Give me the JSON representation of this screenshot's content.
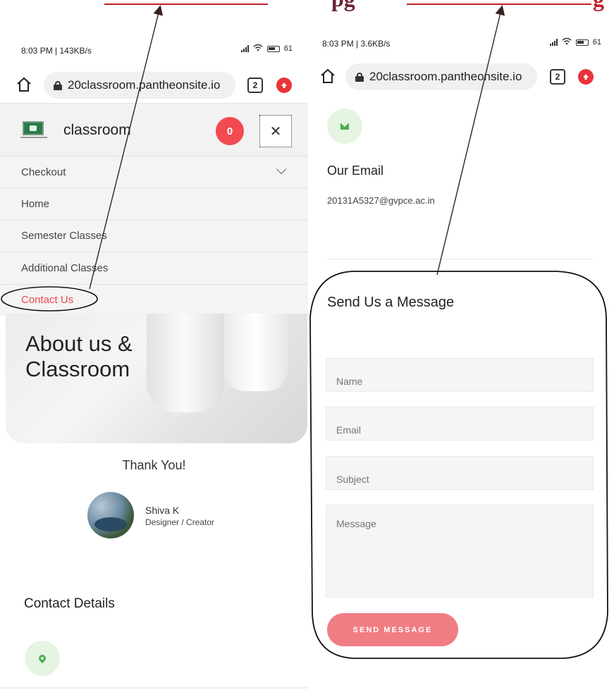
{
  "caption": {
    "mid_text": "pg",
    "right_text": "g"
  },
  "left_phone": {
    "status_time": "8:03 PM | 143KB/s",
    "battery": "61",
    "url": "20classroom.pantheonsite.io",
    "tab_count": "2",
    "site_title": "classroom",
    "cart_count": "0",
    "close_glyph": "✕",
    "menu": [
      {
        "label": "Checkout",
        "has_submenu": true
      },
      {
        "label": "Home"
      },
      {
        "label": "Semester Classes"
      },
      {
        "label": "Additional Classes"
      },
      {
        "label": "Contact Us",
        "active": true
      }
    ],
    "hero_title_line1": "About us &",
    "hero_title_line2": "Classroom",
    "thank_you": "Thank You!",
    "author_name": "Shiva K",
    "author_role": "Designer / Creator",
    "contact_details": "Contact Details"
  },
  "right_phone": {
    "status_time": "8:03 PM | 3.6KB/s",
    "battery": "61",
    "url": "20classroom.pantheonsite.io",
    "tab_count": "2",
    "email_heading": "Our Email",
    "email_value": "20131A5327@gvpce.ac.in",
    "form_title": "Send Us a Message",
    "fields": {
      "name": "Name",
      "email": "Email",
      "subject": "Subject",
      "message": "Message"
    },
    "send_label": "SEND MESSAGE"
  },
  "colors": {
    "accent_red": "#e8474f",
    "button_pink": "#f07d83",
    "annotation_red": "#c0202a",
    "icon_green": "#4caf50"
  }
}
